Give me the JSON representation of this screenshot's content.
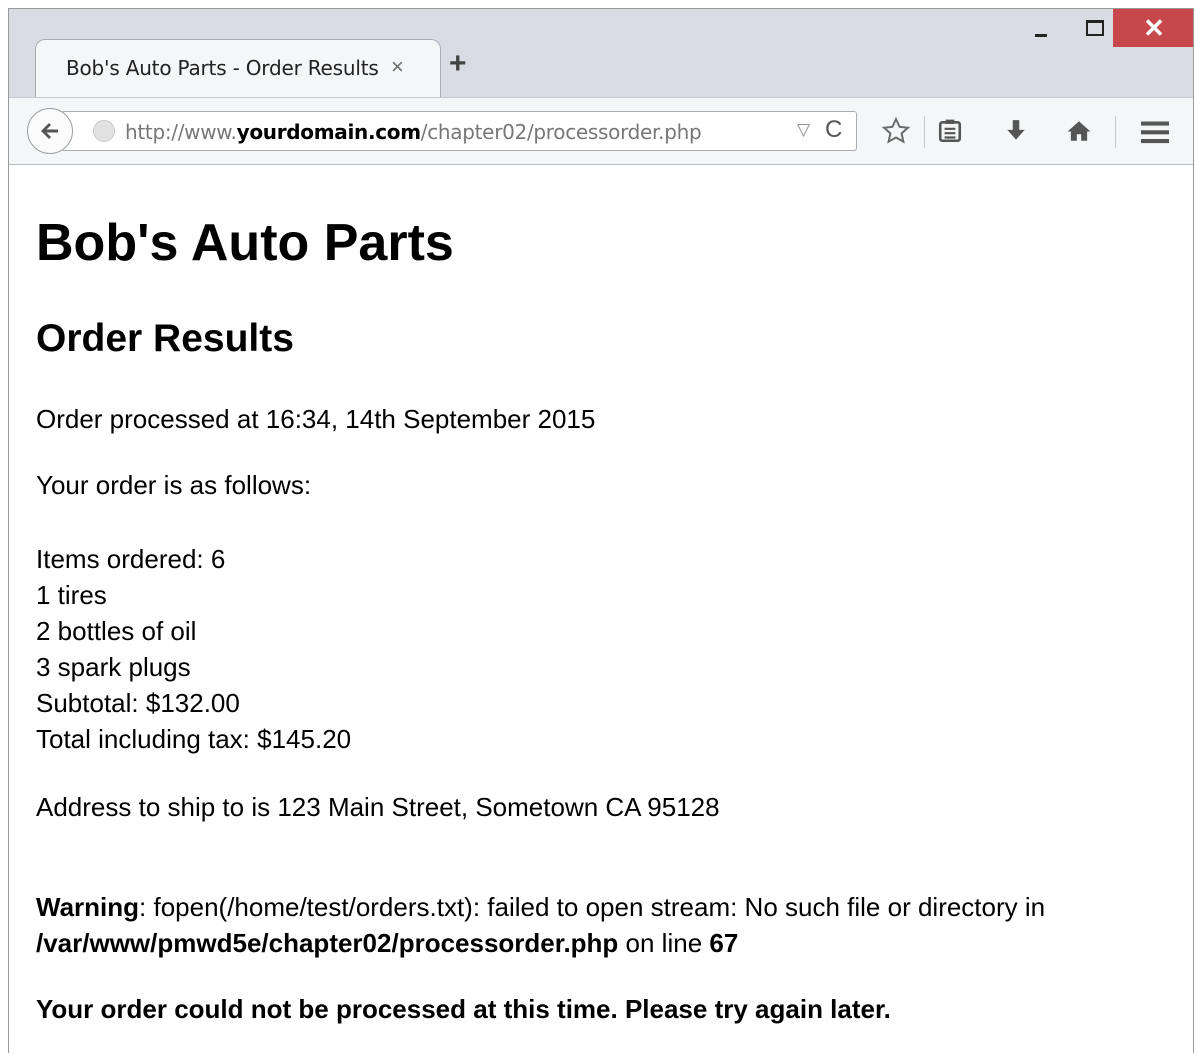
{
  "tab": {
    "title": "Bob's Auto Parts - Order Results",
    "close_icon": "×",
    "new_tab_icon": "+"
  },
  "window_controls": {
    "close_icon": "✕"
  },
  "url": {
    "prefix": "http://www.",
    "domain": "yourdomain.com",
    "path": "/chapter02/processorder.php",
    "dropdown_icon": "▽",
    "reload_icon": "C"
  },
  "toolbar": {
    "icons": [
      "star-icon",
      "reading-list-icon",
      "download-icon",
      "home-icon",
      "menu-icon"
    ]
  },
  "page": {
    "heading": "Bob's Auto Parts",
    "subheading": "Order Results",
    "processed": "Order processed at 16:34, 14th September 2015",
    "intro": "Your order is as follows:",
    "items_ordered": "Items ordered: 6",
    "line1": "1 tires",
    "line2": "2 bottles of oil",
    "line3": "3 spark plugs",
    "subtotal": "Subtotal: $132.00",
    "total": "Total including tax: $145.20",
    "address": "Address to ship to is 123 Main Street, Sometown CA 95128",
    "warning_label": "Warning",
    "warning_text": ": fopen(/home/test/orders.txt): failed to open stream: No such file or directory in",
    "warning_path": "/var/www/pmwd5e/chapter02/processorder.php",
    "warning_online": " on line ",
    "warning_line": "67",
    "error_message": "Your order could not be processed at this time. Please try again later."
  }
}
